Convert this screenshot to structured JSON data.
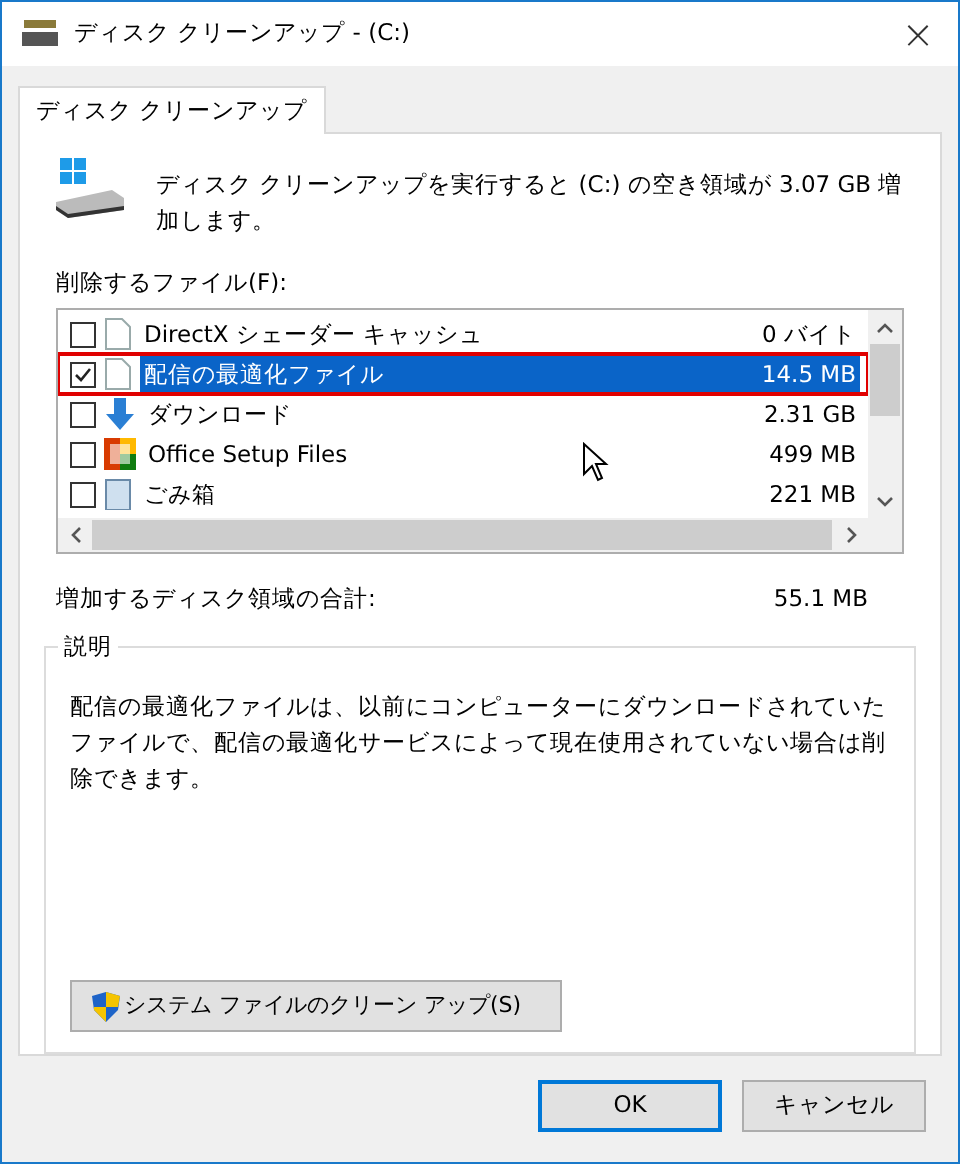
{
  "window": {
    "title": "ディスク クリーンアップ - (C:)",
    "close": "×"
  },
  "tabs": [
    {
      "label": "ディスク クリーンアップ",
      "selected": true
    }
  ],
  "summary": "ディスク クリーンアップを実行すると (C:) の空き領域が 3.07 GB 増加します。",
  "files_label": "削除するファイル(F):",
  "files": [
    {
      "name": "DirectX シェーダー キャッシュ",
      "size": "0 バイト",
      "checked": false,
      "selected": false,
      "kind": "blank"
    },
    {
      "name": "配信の最適化ファイル",
      "size": "14.5 MB",
      "checked": true,
      "selected": true,
      "kind": "blank"
    },
    {
      "name": "ダウンロード",
      "size": "2.31 GB",
      "checked": false,
      "selected": false,
      "kind": "download"
    },
    {
      "name": "Office Setup Files",
      "size": "499 MB",
      "checked": false,
      "selected": false,
      "kind": "office"
    },
    {
      "name": "ごみ箱",
      "size": "221 MB",
      "checked": false,
      "selected": false,
      "kind": "bin"
    }
  ],
  "total_label": "増加するディスク領域の合計:",
  "total_value": "55.1 MB",
  "description": {
    "title": "説明",
    "text": "配信の最適化ファイルは、以前にコンピューターにダウンロードされていたファイルで、配信の最適化サービスによって現在使用されていない場合は削除できます。"
  },
  "system_button": "システム ファイルのクリーン アップ(S)",
  "buttons": [
    {
      "label": "OK",
      "kind": "default"
    },
    {
      "label": "キャンセル",
      "kind": "normal"
    }
  ]
}
